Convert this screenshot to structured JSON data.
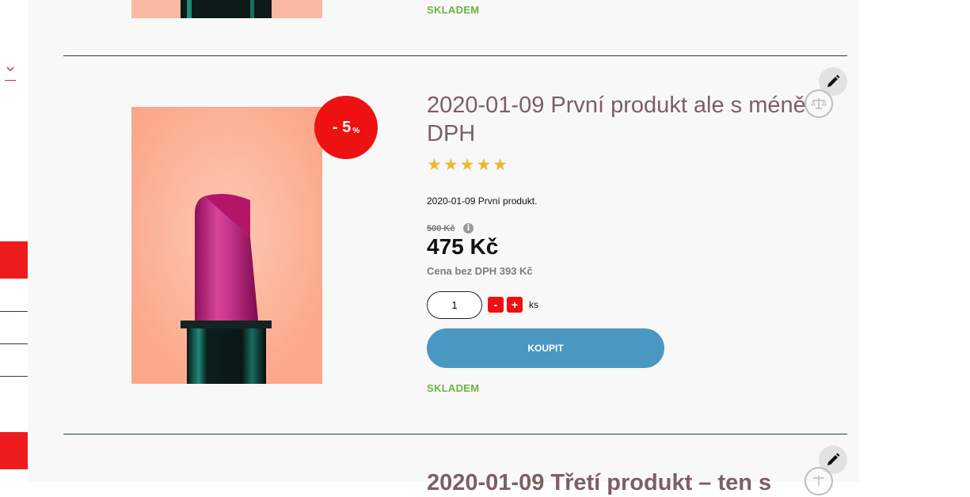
{
  "sidebar": {
    "dropdown_icon": "chevron-down-icon",
    "accent_color": "#ee1c1c"
  },
  "products": [
    {
      "stock_label": "SKLADEM"
    },
    {
      "title": "2020-01-09 První produkt ale s méně DPH",
      "discount_value": "- 5",
      "discount_unit": "%",
      "rating": 5,
      "stars": "★★★★★",
      "description": "2020-01-09 První produkt.",
      "old_price": "500 Kč",
      "info_icon_glyph": "i",
      "price": "475 Kč",
      "price_without_vat": "Cena bez DPH 393 Kč",
      "quantity": "1",
      "minus_label": "-",
      "plus_label": "+",
      "unit": "ks",
      "buy_label": "KOUPIT",
      "stock_label": "SKLADEM",
      "edit_icon": "pencil-icon",
      "compare_icon": "scales-icon"
    },
    {
      "title": "2020-01-09 Třetí produkt – ten s",
      "edit_icon": "pencil-icon",
      "compare_icon": "scales-icon"
    }
  ],
  "colors": {
    "title": "#7c5f63",
    "stock": "#6db33f",
    "buy_button": "#4a97c2",
    "badge": "#ee1111",
    "star": "#f0b733"
  }
}
